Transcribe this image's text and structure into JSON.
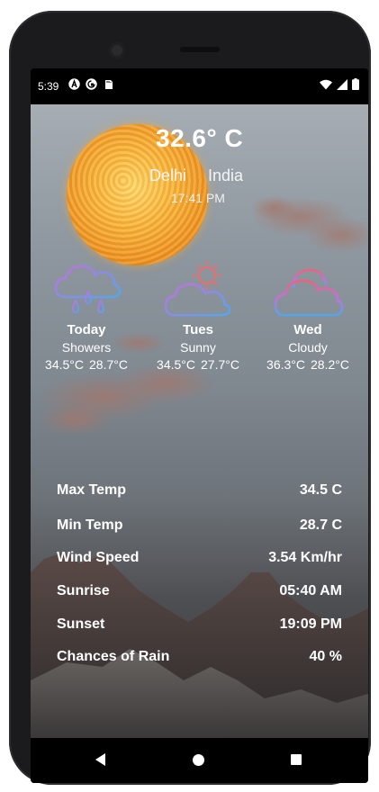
{
  "status_bar": {
    "time": "5:39",
    "left_icons": [
      "a-icon",
      "sync-icon",
      "sd-card-icon"
    ],
    "right_icons": [
      "wifi-icon",
      "signal-icon",
      "battery-icon"
    ]
  },
  "current": {
    "temperature": "32.6° C",
    "city": "Delhi",
    "country": "India",
    "time": "17:41 PM"
  },
  "forecast": [
    {
      "day": "Today",
      "condition": "Showers",
      "max": "34.5°C",
      "min": "28.7°C",
      "icon": "rain-cloud-icon"
    },
    {
      "day": "Tues",
      "condition": "Sunny",
      "max": "34.5°C",
      "min": "27.7°C",
      "icon": "sun-cloud-icon"
    },
    {
      "day": "Wed",
      "condition": "Cloudy",
      "max": "36.3°C",
      "min": "28.2°C",
      "icon": "cloud-icon"
    }
  ],
  "details": [
    {
      "label": "Max Temp",
      "value": "34.5 C"
    },
    {
      "label": "Min Temp",
      "value": "28.7 C"
    },
    {
      "label": "Wind Speed",
      "value": "3.54 Km/hr"
    },
    {
      "label": "Sunrise",
      "value": "05:40 AM"
    },
    {
      "label": "Sunset",
      "value": "19:09 PM"
    },
    {
      "label": "Chances of Rain",
      "value": "40 %"
    }
  ],
  "navigation": {
    "back_icon": "back-triangle-icon",
    "home_icon": "home-circle-icon",
    "recents_icon": "recents-square-icon"
  },
  "colors": {
    "icon_gradient_start": "#c86ee0",
    "icon_gradient_end": "#4fa8f0",
    "sun_icon_color": "#f26a6a",
    "phone_button_accent": "#e0622e"
  }
}
